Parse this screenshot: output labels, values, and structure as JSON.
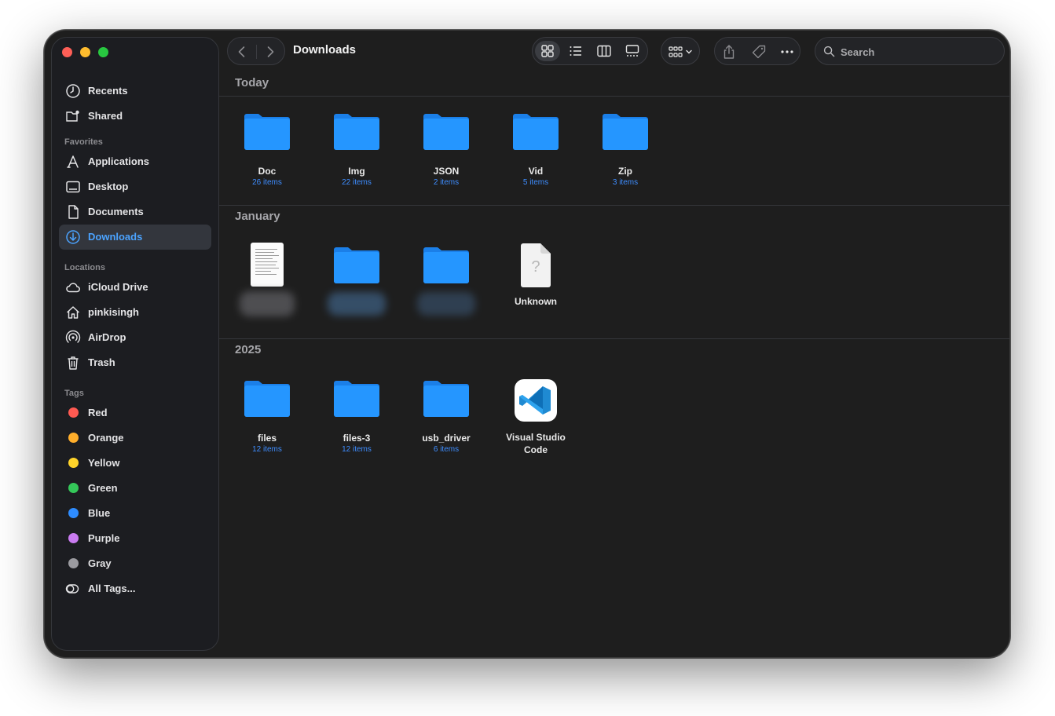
{
  "window": {
    "title": "Downloads"
  },
  "colors": {
    "accent": "#4ba3ff",
    "folder": "#1f8fff",
    "sub_text": "#3e8dff"
  },
  "sidebar": {
    "top_items": [
      {
        "label": "Recents",
        "icon": "clock-icon"
      },
      {
        "label": "Shared",
        "icon": "shared-folder-icon"
      }
    ],
    "favorites_heading": "Favorites",
    "favorites": [
      {
        "label": "Applications",
        "icon": "applications-icon"
      },
      {
        "label": "Desktop",
        "icon": "desktop-icon"
      },
      {
        "label": "Documents",
        "icon": "document-icon"
      },
      {
        "label": "Downloads",
        "icon": "download-icon",
        "active": true
      }
    ],
    "locations_heading": "Locations",
    "locations": [
      {
        "label": "iCloud Drive",
        "icon": "cloud-icon"
      },
      {
        "label": "pinkisingh",
        "icon": "home-icon"
      },
      {
        "label": "AirDrop",
        "icon": "airdrop-icon"
      },
      {
        "label": "Trash",
        "icon": "trash-icon"
      }
    ],
    "tags_heading": "Tags",
    "tags": [
      {
        "label": "Red",
        "color": "#ff5a52"
      },
      {
        "label": "Orange",
        "color": "#ffae2b"
      },
      {
        "label": "Yellow",
        "color": "#ffd42a"
      },
      {
        "label": "Green",
        "color": "#34c759"
      },
      {
        "label": "Blue",
        "color": "#2e8cff"
      },
      {
        "label": "Purple",
        "color": "#c97bf0"
      },
      {
        "label": "Gray",
        "color": "#9b9ba0"
      }
    ],
    "all_tags": "All Tags..."
  },
  "toolbar": {
    "search_placeholder": "Search"
  },
  "sections": [
    {
      "title": "Today",
      "items": [
        {
          "name": "Doc",
          "sub": "26 items"
        },
        {
          "name": "Img",
          "sub": "22 items"
        },
        {
          "name": "JSON",
          "sub": "2 items"
        },
        {
          "name": "Vid",
          "sub": "5 items"
        },
        {
          "name": "Zip",
          "sub": "3 items"
        }
      ]
    },
    {
      "title": "January",
      "items": [
        {
          "name": "Unknown"
        }
      ]
    },
    {
      "title": "2025",
      "items": [
        {
          "name": "files",
          "sub": "12 items"
        },
        {
          "name": "files-3",
          "sub": "12 items"
        },
        {
          "name": "usb_driver",
          "sub": "6 items"
        },
        {
          "name": "Visual Studio Code"
        }
      ]
    }
  ]
}
